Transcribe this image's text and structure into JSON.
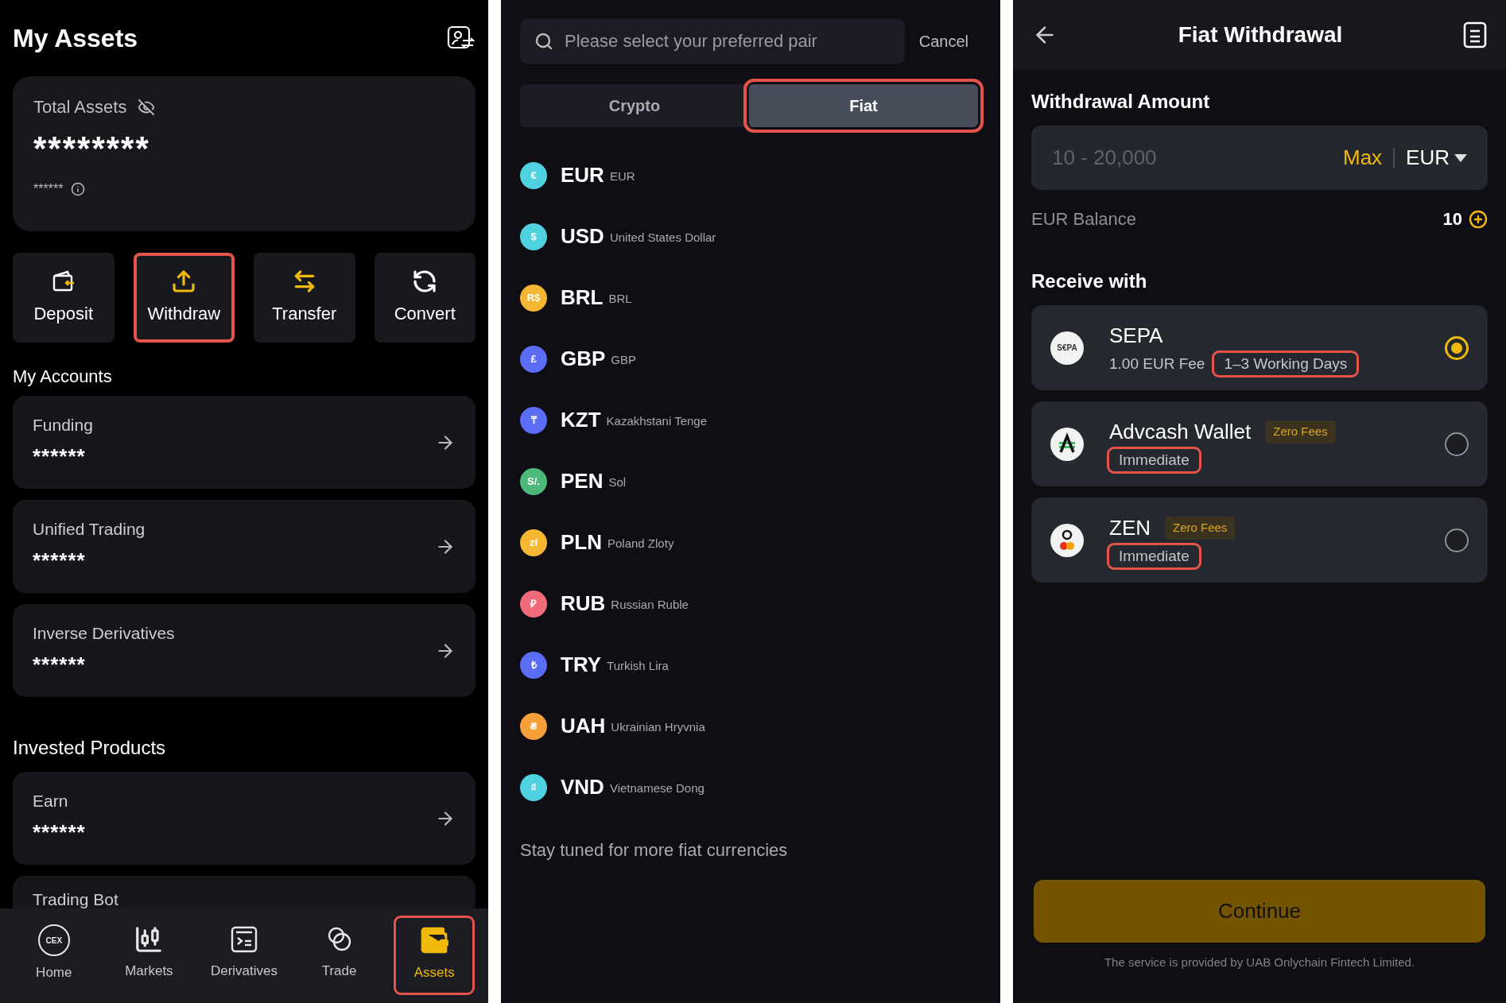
{
  "assets_screen": {
    "title": "My Assets",
    "total_card": {
      "label": "Total Assets",
      "value": "********",
      "sub_value": "******"
    },
    "actions": [
      {
        "label": "Deposit",
        "highlighted": false
      },
      {
        "label": "Withdraw",
        "highlighted": true
      },
      {
        "label": "Transfer",
        "highlighted": false
      },
      {
        "label": "Convert",
        "highlighted": false
      }
    ],
    "accounts_heading": "My Accounts",
    "accounts": [
      {
        "name": "Funding",
        "value": "******"
      },
      {
        "name": "Unified Trading",
        "value": "******"
      },
      {
        "name": "Inverse Derivatives",
        "value": "******"
      }
    ],
    "invested_heading": "Invested Products",
    "invested": [
      {
        "name": "Earn",
        "value": "******"
      },
      {
        "name": "Trading Bot"
      }
    ],
    "nav": [
      {
        "label": "Home",
        "icon_text": "CEX",
        "selected": false,
        "highlighted": false
      },
      {
        "label": "Markets",
        "selected": false,
        "highlighted": false
      },
      {
        "label": "Derivatives",
        "selected": false,
        "highlighted": false
      },
      {
        "label": "Trade",
        "selected": false,
        "highlighted": false
      },
      {
        "label": "Assets",
        "selected": true,
        "highlighted": true
      }
    ]
  },
  "currency_screen": {
    "search": {
      "placeholder": "Please select your preferred pair"
    },
    "cancel": "Cancel",
    "tabs": [
      {
        "label": "Crypto",
        "selected": false,
        "highlighted": false
      },
      {
        "label": "Fiat",
        "selected": true,
        "highlighted": true
      }
    ],
    "currencies": [
      {
        "symbol": "€",
        "code": "EUR",
        "name": "EUR",
        "color": "#4fd1e0"
      },
      {
        "symbol": "$",
        "code": "USD",
        "name": "United States Dollar",
        "color": "#4fd1e0"
      },
      {
        "symbol": "R$",
        "code": "BRL",
        "name": "BRL",
        "color": "#f5b731"
      },
      {
        "symbol": "£",
        "code": "GBP",
        "name": "GBP",
        "color": "#5b6cf5"
      },
      {
        "symbol": "₸",
        "code": "KZT",
        "name": "Kazakhstani Tenge",
        "color": "#5b6cf5"
      },
      {
        "symbol": "S/.",
        "code": "PEN",
        "name": "Sol",
        "color": "#4cb87a"
      },
      {
        "symbol": "zł",
        "code": "PLN",
        "name": "Poland Zloty",
        "color": "#f5b731"
      },
      {
        "symbol": "₽",
        "code": "RUB",
        "name": "Russian Ruble",
        "color": "#f06b7a"
      },
      {
        "symbol": "₺",
        "code": "TRY",
        "name": "Turkish Lira",
        "color": "#5b6cf5"
      },
      {
        "symbol": "₴",
        "code": "UAH",
        "name": "Ukrainian Hryvnia",
        "color": "#f5a03a"
      },
      {
        "symbol": "₫",
        "code": "VND",
        "name": "Vietnamese Dong",
        "color": "#4fd1e0"
      }
    ],
    "footer_note": "Stay tuned for more fiat currencies"
  },
  "withdrawal_screen": {
    "title": "Fiat Withdrawal",
    "amount_label": "Withdrawal Amount",
    "amount_field": {
      "placeholder": "10 - 20,000",
      "max": "Max",
      "currency": "EUR"
    },
    "balance_label": "EUR Balance",
    "balance_value": "10",
    "receive_heading": "Receive with",
    "methods": [
      {
        "name": "SEPA",
        "logo_text": "S€PA",
        "fee": "1.00 EUR Fee",
        "speed": "1–3 Working Days",
        "speed_highlighted": true,
        "selected": true
      },
      {
        "name": "Advcash Wallet",
        "tag": "Zero Fees",
        "speed": "Immediate",
        "speed_highlighted": true,
        "selected": false
      },
      {
        "name": "ZEN",
        "tag": "Zero Fees",
        "speed": "Immediate",
        "speed_highlighted": true,
        "selected": false
      }
    ],
    "continue_button": "Continue",
    "disclaimer": "The service is provided by UAB Onlychain Fintech Limited."
  }
}
